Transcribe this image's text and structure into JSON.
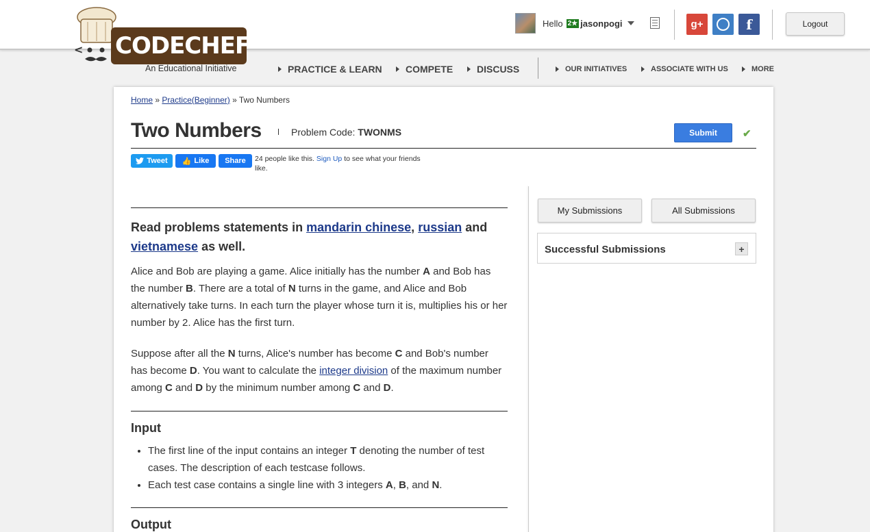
{
  "brand": {
    "name": "CODECHEF",
    "tagline": "An Educational Initiative"
  },
  "user": {
    "greeting": "Hello",
    "rating_badge": "2★",
    "username": "jasonpogi"
  },
  "header": {
    "logout_label": "Logout"
  },
  "nav": {
    "primary": [
      "PRACTICE & LEARN",
      "COMPETE",
      "DISCUSS"
    ],
    "secondary": [
      "OUR INITIATIVES",
      "ASSOCIATE WITH US",
      "MORE"
    ]
  },
  "breadcrumb": {
    "home": "Home",
    "sep1": "»",
    "section": "Practice(Beginner)",
    "sep2": "»",
    "current": "Two Numbers"
  },
  "problem": {
    "title": "Two Numbers",
    "code_label": "Problem Code:",
    "code": "TWONMS",
    "submit_label": "Submit",
    "check_icon": "✔"
  },
  "share": {
    "tweet_label": "Tweet",
    "like_label": "Like",
    "share_label": "Share",
    "like_text_pre": "24 people like this.",
    "signup_label": "Sign Up",
    "like_text_post": "to see what your friends like."
  },
  "statement": {
    "read_pre": "Read problems statements in",
    "lang1": "mandarin chinese",
    "comma": ",",
    "lang2": "russian",
    "and": "and",
    "lang3": "vietnamese",
    "read_post": "as well.",
    "p1": [
      {
        "t": "Alice and Bob are playing a game. Alice initially has the number "
      },
      {
        "b": "A"
      },
      {
        "t": " and Bob has the number "
      },
      {
        "b": "B"
      },
      {
        "t": ". There are a total of "
      },
      {
        "b": "N"
      },
      {
        "t": " turns in the game, and Alice and Bob alternatively take turns. In each turn the player whose turn it is, multiplies his or her number by 2. Alice has the first turn."
      }
    ],
    "p2": [
      {
        "t": "Suppose after all the "
      },
      {
        "b": "N"
      },
      {
        "t": " turns, Alice's number has become "
      },
      {
        "b": "C"
      },
      {
        "t": " and Bob's number has become "
      },
      {
        "b": "D"
      },
      {
        "t": ". You want to calculate the "
      },
      {
        "a": "integer division"
      },
      {
        "t": " of the maximum number among "
      },
      {
        "b": "C"
      },
      {
        "t": " and "
      },
      {
        "b": "D"
      },
      {
        "t": " by the minimum number among "
      },
      {
        "b": "C"
      },
      {
        "t": " and "
      },
      {
        "b": "D"
      },
      {
        "t": "."
      }
    ],
    "input_heading": "Input",
    "input_items": [
      [
        {
          "t": "The first line of the input contains an integer "
        },
        {
          "b": "T"
        },
        {
          "t": " denoting the number of test cases. The description of each testcase follows."
        }
      ],
      [
        {
          "t": "Each test case contains a single line with 3 integers "
        },
        {
          "b": "A"
        },
        {
          "t": ", "
        },
        {
          "b": "B"
        },
        {
          "t": ", and "
        },
        {
          "b": "N"
        },
        {
          "t": "."
        }
      ]
    ],
    "output_heading": "Output"
  },
  "sidebar": {
    "my_submissions": "My Submissions",
    "all_submissions": "All Submissions",
    "successful_title": "Successful Submissions",
    "expand_icon": "+"
  },
  "colors": {
    "accent": "#3a7de0",
    "brand_brown": "#5b3a1c",
    "link": "#1d3a8a",
    "success": "#6aaa4a"
  }
}
